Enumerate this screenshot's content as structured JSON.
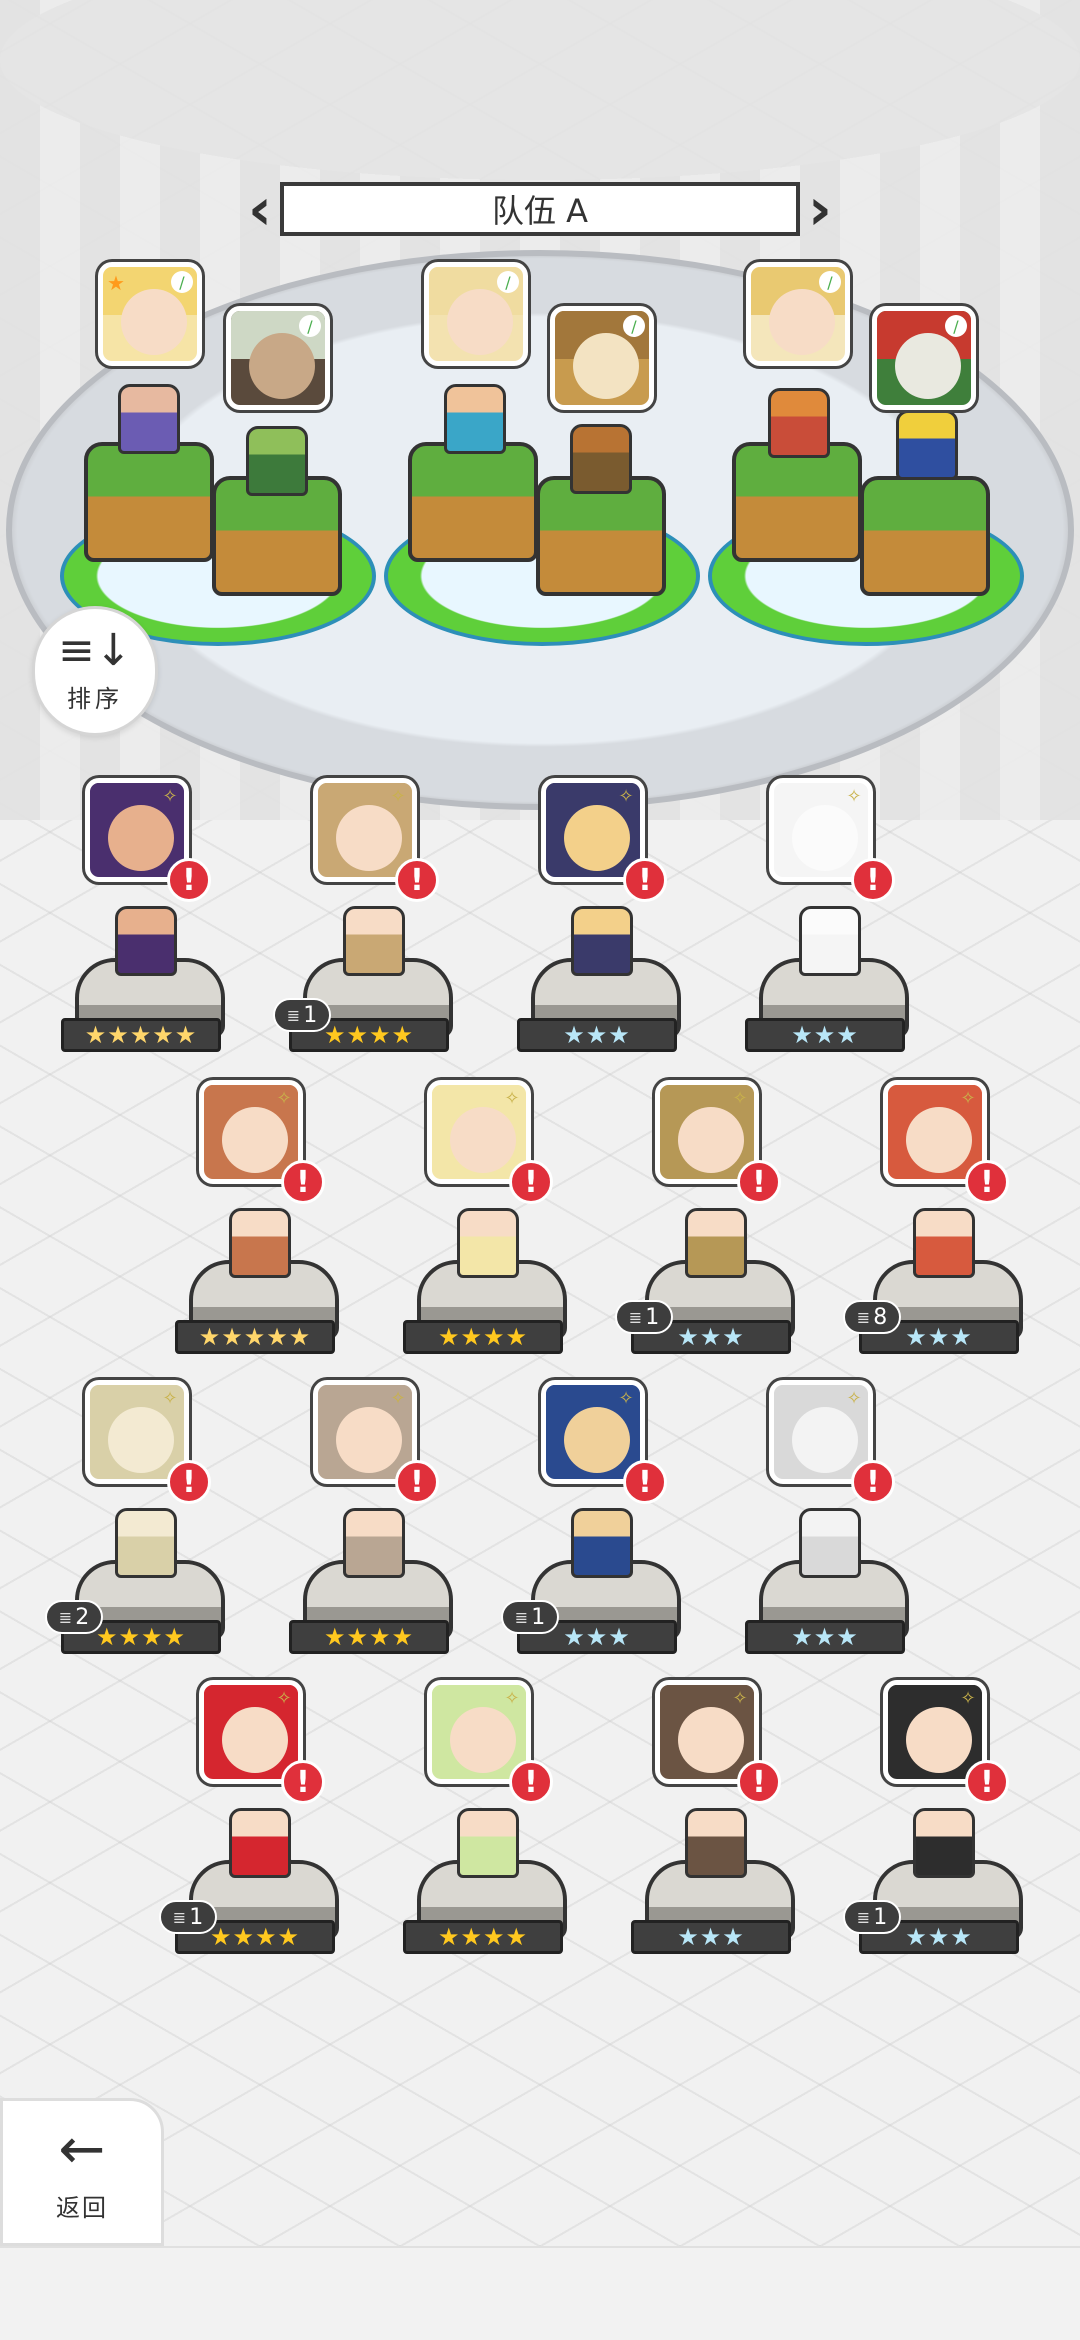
{
  "team": {
    "label": "队伍 A",
    "prev_icon": "chevron-left-icon",
    "next_icon": "chevron-right-icon"
  },
  "team_slots": [
    {
      "leader": true
    },
    {
      "leader": false
    },
    {
      "leader": false
    },
    {
      "leader": false
    },
    {
      "leader": false
    },
    {
      "leader": false
    }
  ],
  "sort": {
    "label": "排序",
    "icon": "sort-icon"
  },
  "back": {
    "label": "返回",
    "icon": "arrow-left-icon"
  },
  "heroes": [
    {
      "stars": "★★★★★",
      "rarity": "rainbow",
      "dupe": ""
    },
    {
      "stars": "★★★★",
      "rarity": "gold",
      "dupe": "1"
    },
    {
      "stars": "★★★",
      "rarity": "silver",
      "dupe": ""
    },
    {
      "stars": "★★★",
      "rarity": "silver",
      "dupe": ""
    },
    {
      "stars": "★★★★★",
      "rarity": "rainbow",
      "dupe": ""
    },
    {
      "stars": "★★★★",
      "rarity": "gold",
      "dupe": ""
    },
    {
      "stars": "★★★",
      "rarity": "silver",
      "dupe": "1"
    },
    {
      "stars": "★★★",
      "rarity": "silver",
      "dupe": "8"
    },
    {
      "stars": "★★★★",
      "rarity": "gold",
      "dupe": "2"
    },
    {
      "stars": "★★★★",
      "rarity": "gold",
      "dupe": ""
    },
    {
      "stars": "★★★",
      "rarity": "silver",
      "dupe": "1"
    },
    {
      "stars": "★★★",
      "rarity": "silver",
      "dupe": ""
    },
    {
      "stars": "★★★★",
      "rarity": "gold",
      "dupe": "1"
    },
    {
      "stars": "★★★★",
      "rarity": "gold",
      "dupe": ""
    },
    {
      "stars": "★★★",
      "rarity": "silver",
      "dupe": ""
    },
    {
      "stars": "★★★",
      "rarity": "silver",
      "dupe": "1"
    }
  ],
  "colors": {
    "alert": "#e0303b",
    "star_gold": "#ffc81f",
    "star_silver": "#b8e6f7",
    "grass": "#5fae3f"
  }
}
